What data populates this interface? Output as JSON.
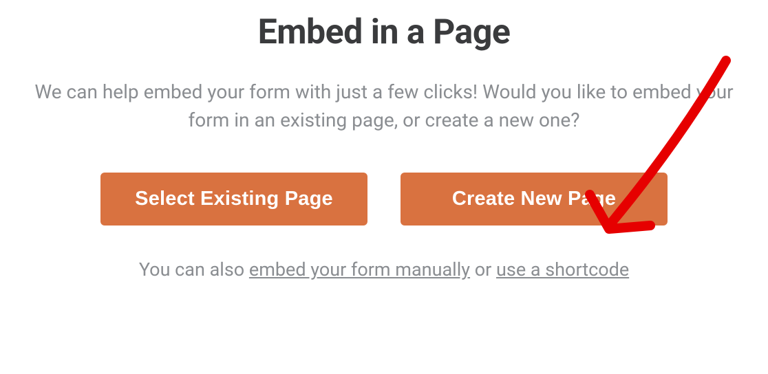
{
  "title": "Embed in a Page",
  "description": "We can help embed your form with just a few clicks! Would you like to embed your form in an existing page, or create a new one?",
  "buttons": {
    "select_existing": "Select Existing Page",
    "create_new": "Create New Page"
  },
  "footer": {
    "prefix": "You can also ",
    "link1": "embed your form manually",
    "middle": " or ",
    "link2": "use a shortcode"
  },
  "colors": {
    "button_bg": "#d97240",
    "text_heading": "#3a3b3d",
    "text_muted": "#8a8d91",
    "annotation": "#e60000"
  }
}
